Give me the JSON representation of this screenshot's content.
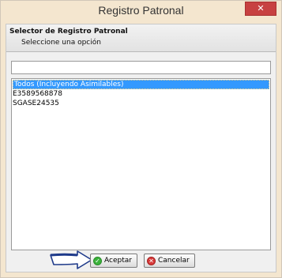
{
  "window": {
    "title": "Registro Patronal",
    "close_label": "✕"
  },
  "header": {
    "title": "Selector de Registro Patronal",
    "subtitle": "Seleccione una opción"
  },
  "search": {
    "value": "",
    "placeholder": ""
  },
  "list": {
    "items": [
      {
        "label": "Todos (Incluyendo Asimilables)",
        "selected": true
      },
      {
        "label": "E3589568878",
        "selected": false
      },
      {
        "label": "SGASE24535",
        "selected": false
      }
    ]
  },
  "buttons": {
    "accept_label": "Aceptar",
    "accept_icon": "check-icon",
    "cancel_label": "Cancelar",
    "cancel_icon": "cancel-icon"
  },
  "colors": {
    "selection": "#3399ff",
    "window_frame": "#f4e6cf",
    "close_button": "#c74141",
    "arrow": "#1e3a8a"
  }
}
